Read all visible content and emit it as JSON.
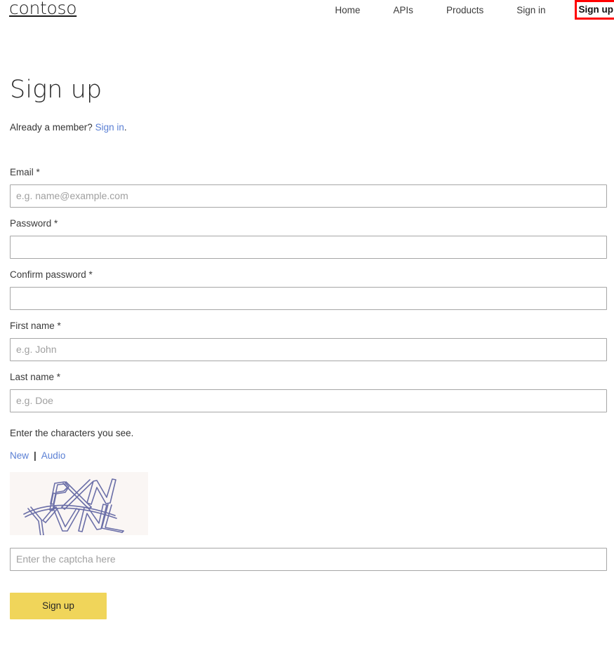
{
  "header": {
    "brand": "contoso",
    "nav": [
      {
        "label": "Home",
        "active": false,
        "highlighted": false
      },
      {
        "label": "APIs",
        "active": false,
        "highlighted": false
      },
      {
        "label": "Products",
        "active": false,
        "highlighted": false
      },
      {
        "label": "Sign in",
        "active": false,
        "highlighted": false
      },
      {
        "label": "Sign up",
        "active": true,
        "highlighted": true
      }
    ],
    "highlight_color": "#ff0000"
  },
  "page": {
    "title": "Sign up",
    "member_prompt": "Already a member?",
    "member_link": "Sign in",
    "member_suffix": "."
  },
  "form": {
    "fields": {
      "email": {
        "label": "Email *",
        "placeholder": "e.g. name@example.com",
        "value": ""
      },
      "password": {
        "label": "Password *",
        "placeholder": "",
        "value": ""
      },
      "confirm_password": {
        "label": "Confirm password *",
        "placeholder": "",
        "value": ""
      },
      "first_name": {
        "label": "First name *",
        "placeholder": "e.g. John",
        "value": ""
      },
      "last_name": {
        "label": "Last name *",
        "placeholder": "e.g. Doe",
        "value": ""
      },
      "captcha": {
        "placeholder": "Enter the captcha here",
        "value": ""
      }
    },
    "captcha": {
      "prompt": "Enter the characters you see.",
      "new_link": "New",
      "separator": "|",
      "audio_link": "Audio",
      "image_alt": "distorted-characters-captcha",
      "image_background": "#faf6f4",
      "image_stroke": "#6b6fa8"
    },
    "submit_label": "Sign up",
    "submit_color": "#f0d55a"
  }
}
